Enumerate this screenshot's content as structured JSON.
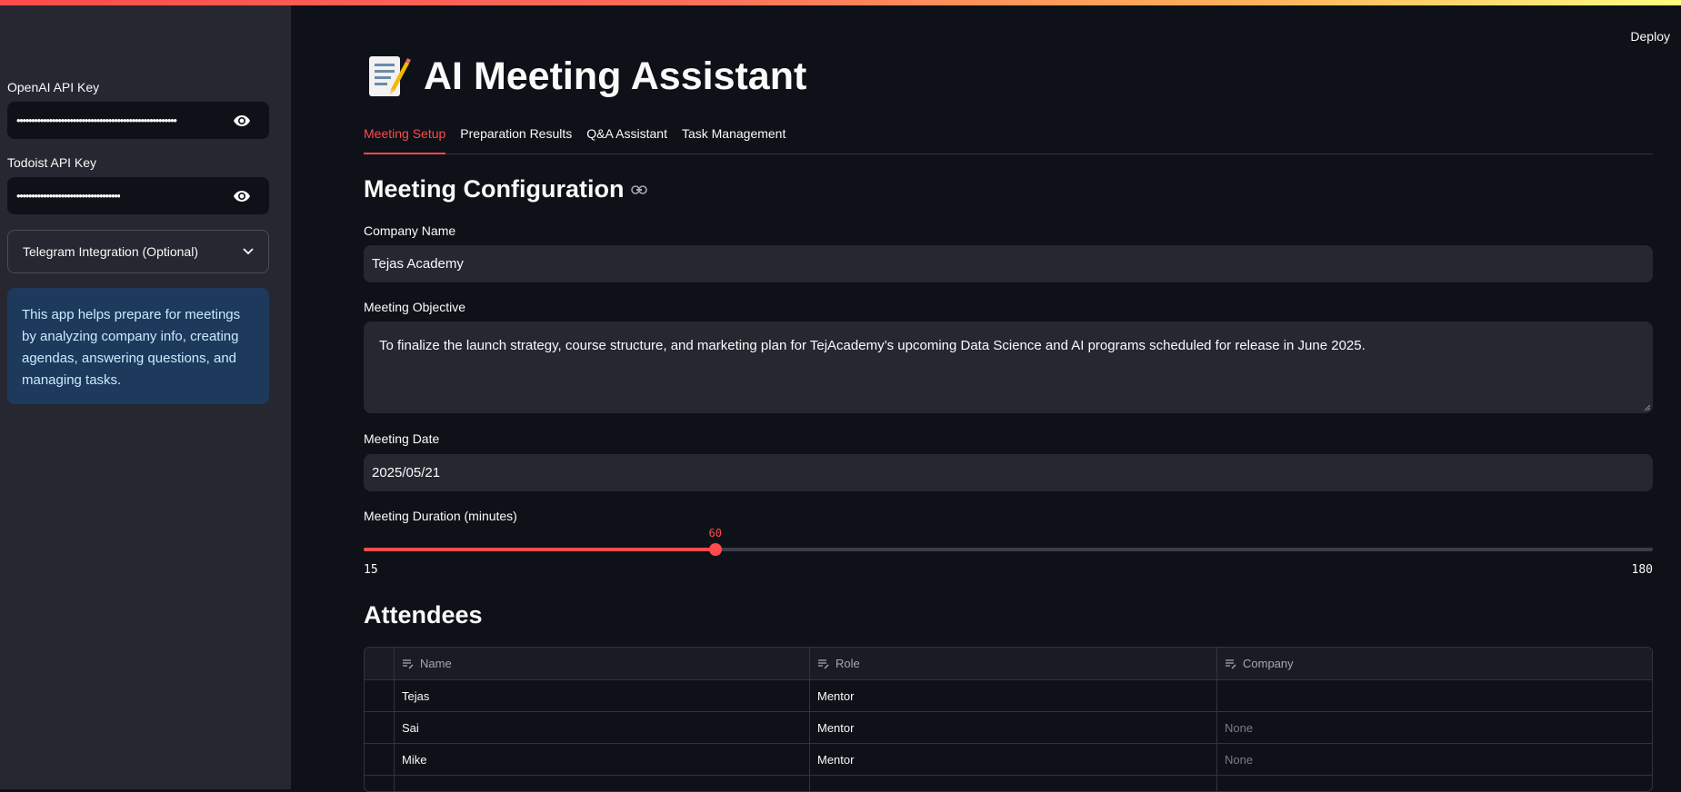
{
  "header": {
    "deploy_label": "Deploy"
  },
  "sidebar": {
    "openai_key": {
      "label": "OpenAI API Key",
      "masked_value": "••••••••••••••••••••••••••••••••••••••••••••••••••••••"
    },
    "todoist_key": {
      "label": "Todoist API Key",
      "masked_value": "••••••••••••••••••••••••••••••••••••••••••••••••"
    },
    "telegram_expander": {
      "label": "Telegram Integration (Optional)"
    },
    "info_text": "This app helps prepare for meetings by analyzing company info, creating agendas, answering questions, and managing tasks."
  },
  "main": {
    "title": "AI Meeting Assistant",
    "title_icon": "memo-icon",
    "tabs": [
      {
        "label": "Meeting Setup",
        "active": true
      },
      {
        "label": "Preparation Results",
        "active": false
      },
      {
        "label": "Q&A Assistant",
        "active": false
      },
      {
        "label": "Task Management",
        "active": false
      }
    ],
    "config_heading": "Meeting Configuration",
    "company_name": {
      "label": "Company Name",
      "value": "Tejas Academy"
    },
    "objective": {
      "label": "Meeting Objective",
      "value": "To finalize the launch strategy, course structure, and marketing plan for TejAcademy’s upcoming Data Science and AI programs scheduled for release in June 2025."
    },
    "date": {
      "label": "Meeting Date",
      "value": "2025/05/21"
    },
    "duration": {
      "label": "Meeting Duration (minutes)",
      "value": 60,
      "min": 15,
      "max": 180
    },
    "attendees_heading": "Attendees",
    "attendees": {
      "columns": [
        "Name",
        "Role",
        "Company"
      ],
      "rows": [
        [
          "Tejas",
          "Mentor",
          ""
        ],
        [
          "Sai",
          "Mentor",
          "None"
        ],
        [
          "Mike",
          "Mentor",
          "None"
        ]
      ]
    }
  },
  "colors": {
    "accent": "#ff4b4b",
    "sidebar_bg": "#262730",
    "app_bg": "#0e1117",
    "info_bg": "#1d3a5c"
  }
}
